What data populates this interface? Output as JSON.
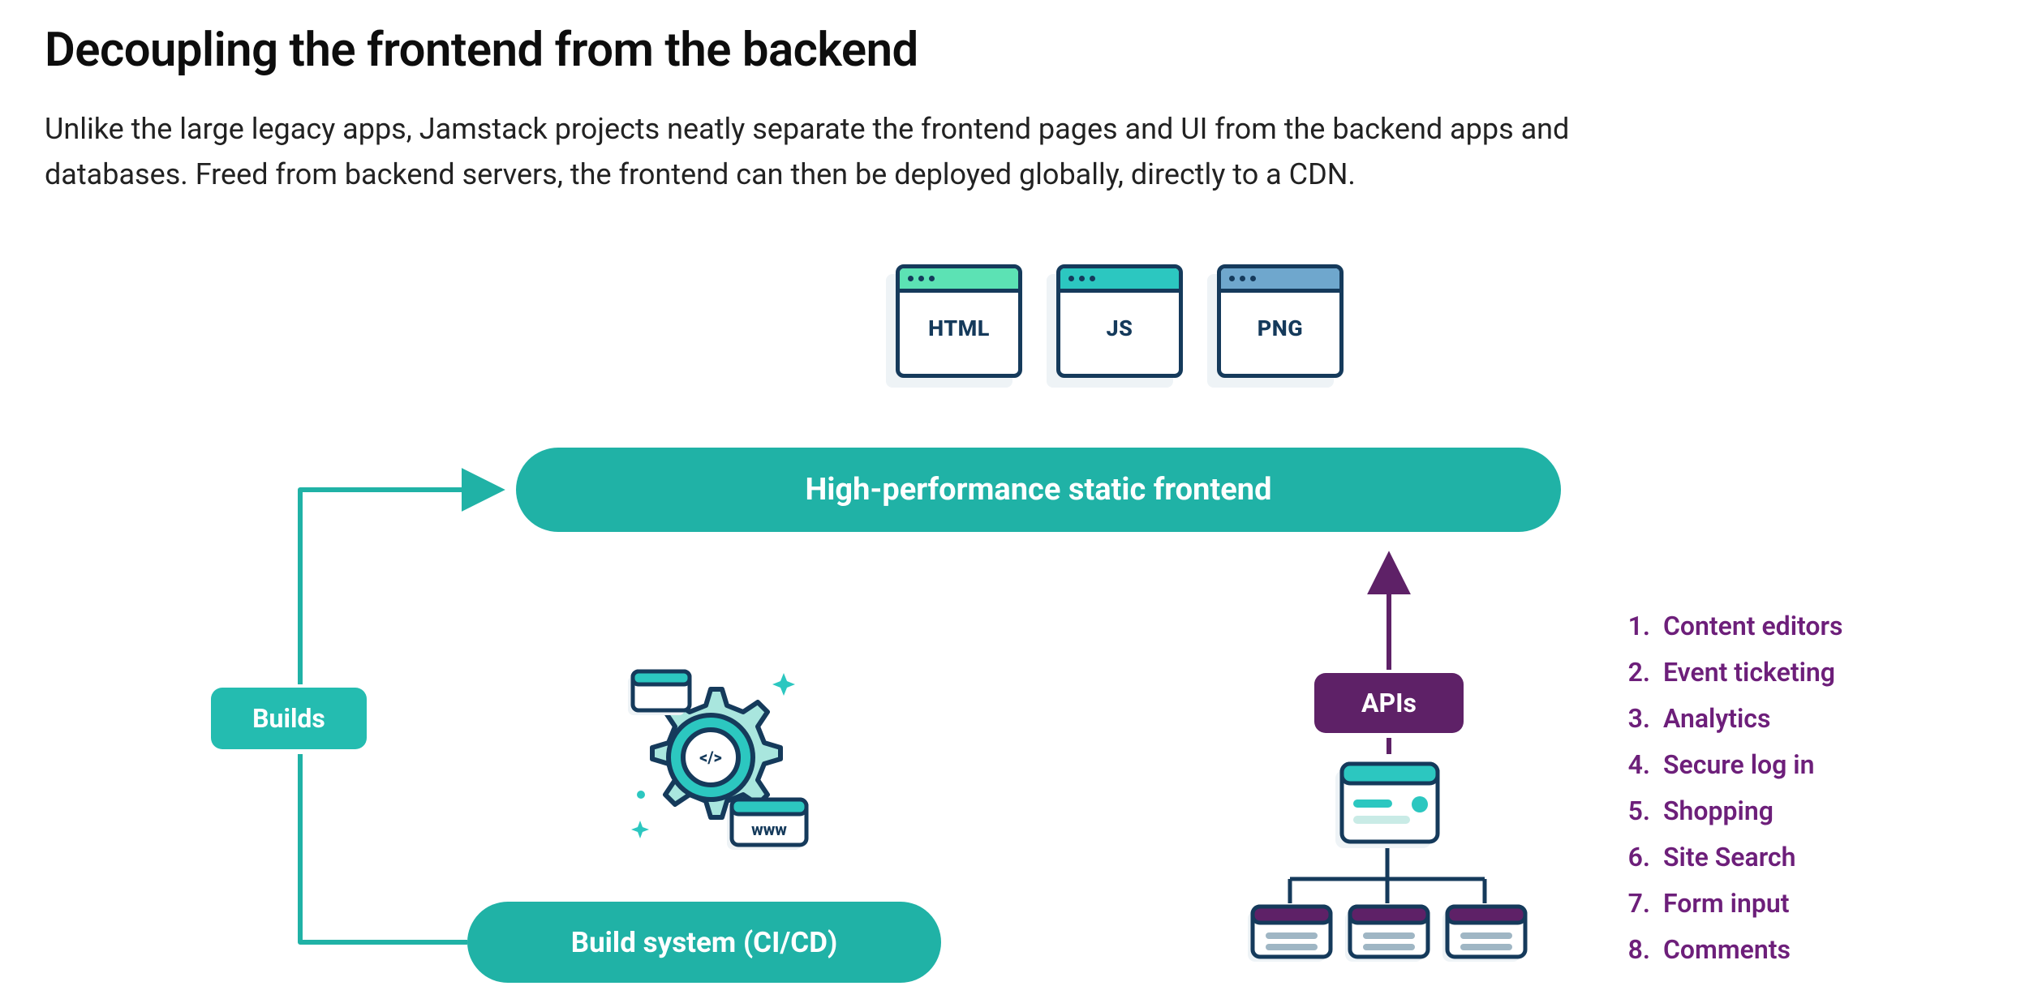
{
  "heading": "Decoupling the frontend from the backend",
  "intro": "Unlike the large legacy apps, Jamstack projects neatly separate the frontend pages and UI from the backend apps and databases. Freed from backend servers, the frontend can then be deployed globally, directly to a CDN.",
  "files": {
    "html": "HTML",
    "js": "JS",
    "png": "PNG"
  },
  "pills": {
    "frontend": "High-performance static frontend",
    "build_system": "Build system  (CI/CD)"
  },
  "builds_label": "Builds",
  "apis_label": "APIs",
  "api_examples": [
    "Content editors",
    "Event ticketing",
    "Analytics",
    "Secure log in",
    "Shopping",
    "Site Search",
    "Form input",
    "Comments"
  ],
  "colors": {
    "teal": "#20b2a6",
    "teal_light": "#24bcb0",
    "navy": "#153a5b",
    "purple": "#5e2167",
    "magenta_text": "#6d1f7a",
    "file_html_hdr": "#5ce2b4",
    "file_js_hdr": "#2cc7c0",
    "file_png_hdr": "#6fa7cd"
  },
  "gear_www": "www"
}
